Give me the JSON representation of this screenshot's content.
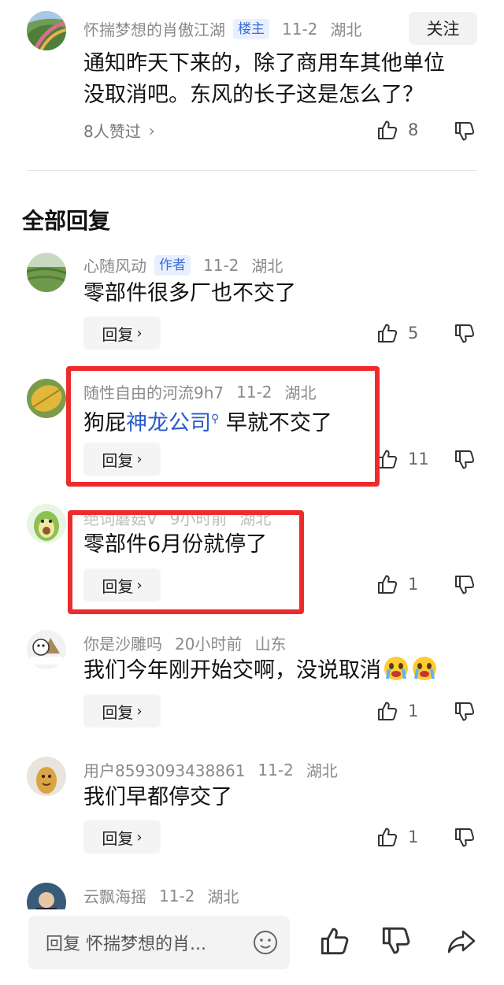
{
  "op_comment": {
    "username": "怀揣梦想的肖傲江湖",
    "badge": "楼主",
    "date": "11-2",
    "location": "湖北",
    "follow_label": "关注",
    "content_line1": "通知昨天下来的，除了商用车其他单位",
    "content_line2": "没取消吧。东风的长子这是怎么了？",
    "likers_text": "8人赞过",
    "like_count": "8"
  },
  "section_title": "全部回复",
  "replies": [
    {
      "username": "心随风动",
      "badge": "作者",
      "date": "11-2",
      "location": "湖北",
      "content": "零部件很多厂也不交了",
      "reply_label": "回复",
      "like_count": "5"
    },
    {
      "username": "随性自由的河流9h7",
      "date": "11-2",
      "location": "湖北",
      "content_before": "狗屁",
      "content_link": "神龙公司",
      "content_after": "早就不交了",
      "reply_label": "回复",
      "like_count": "11"
    },
    {
      "username": "绝词蘑菇V",
      "date": "9小时前",
      "location": "湖北",
      "content": "零部件6月份就停了",
      "reply_label": "回复",
      "like_count": "1"
    },
    {
      "username": "你是沙雕吗",
      "date": "20小时前",
      "location": "山东",
      "content": "我们今年刚开始交啊，没说取消",
      "reply_label": "回复",
      "like_count": "1"
    },
    {
      "username": "用户8593093438861",
      "date": "11-2",
      "location": "湖北",
      "content": "我们早都停交了",
      "reply_label": "回复",
      "like_count": "1"
    },
    {
      "username": "云飘海摇",
      "date": "11-2",
      "location": "湖北"
    }
  ],
  "bottom_bar": {
    "input_placeholder": "回复 怀揣梦想的肖..."
  },
  "colors": {
    "highlight_box": "#ee2b2b",
    "link": "#2a5bc9",
    "badge_text": "#3b6fd6"
  }
}
